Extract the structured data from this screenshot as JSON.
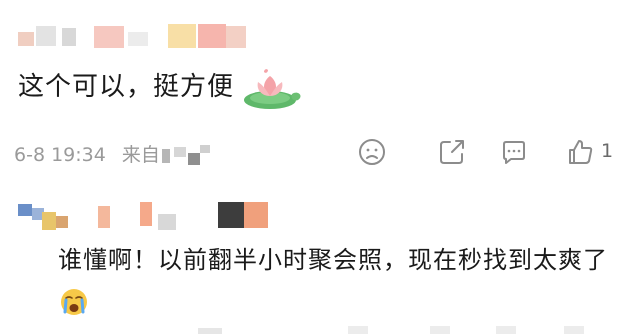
{
  "comments": [
    {
      "text": "这个可以，挺方便",
      "emoji": "lotus-sticker",
      "date": "6-8 19:34",
      "source_prefix": "来自",
      "like_count": "1",
      "actions": [
        "sad-face-icon",
        "share-icon",
        "comment-icon",
        "like-icon"
      ]
    },
    {
      "text": "谁懂啊！以前翻半小时聚会照，现在秒找到太爽了",
      "emoji": "crying-face-emoji"
    }
  ],
  "colors": {
    "meta_text": "#9a9a9a",
    "icon_stroke": "#8c8c8c",
    "lotus_pink": "#f4a3a8",
    "leaf_green": "#5fb86a"
  }
}
